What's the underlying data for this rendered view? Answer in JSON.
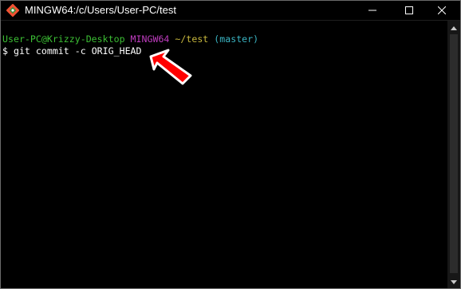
{
  "window": {
    "title": "MINGW64:/c/Users/User-PC/test",
    "icon": "git-bash-icon",
    "controls": {
      "minimize": "minimize-icon",
      "maximize": "maximize-icon",
      "close": "close-icon"
    }
  },
  "terminal": {
    "prompt_line": {
      "user_host": "User-PC@Krizzy-Desktop",
      "system": "MINGW64",
      "path": "~/test",
      "branch": "(master)"
    },
    "command_line": {
      "prompt": "$",
      "command": "git commit -c ORIG_HEAD"
    }
  },
  "annotation": {
    "icon": "red-arrow-pointer",
    "color": "#ff0000"
  },
  "colors": {
    "user_host": "#3cbf34",
    "system": "#bf3cbf",
    "path": "#c7b73d",
    "branch": "#3ab4c2",
    "background": "#000000"
  }
}
